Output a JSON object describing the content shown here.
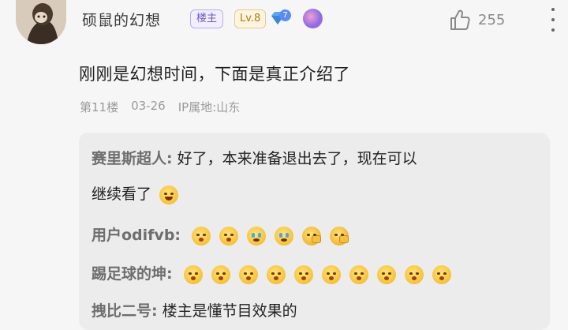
{
  "author": {
    "avatar_icon": "cartoon-avatar-icon",
    "name": "硕鼠的幻想",
    "owner_badge": "楼主",
    "level": "Lv.8",
    "diamond_level": "7",
    "like_count": "255"
  },
  "post": {
    "text": "刚刚是幻想时间，下面是真正介绍了",
    "floor": "第11楼",
    "date": "03-26",
    "ip": "IP属地:山东"
  },
  "replies": [
    {
      "name": "赛里斯超人:",
      "text_line1": "好了，本来准备退出去了，现在可以",
      "text_line2": "继续看了",
      "emojis": [
        "laugh-emoji"
      ]
    },
    {
      "name": "用户odifvb:",
      "emojis": [
        "shock-emoji",
        "shock-emoji",
        "cry-emoji",
        "cry-emoji",
        "facepalm-emoji",
        "facepalm-emoji"
      ]
    },
    {
      "name": "踢足球的坤:",
      "emojis": [
        "shock-emoji",
        "shock-emoji",
        "shock-emoji",
        "shock-emoji",
        "shock-emoji",
        "shock-emoji",
        "shock-emoji",
        "shock-emoji",
        "shock-emoji",
        "shock-emoji"
      ]
    },
    {
      "name": "拽比二号:",
      "text_line1": "楼主是懂节目效果的"
    }
  ],
  "colors": {
    "background": "#f6f6f6",
    "reply_box": "#ececec",
    "owner_badge": "#6a5acd",
    "level_badge": "#b07a18"
  }
}
